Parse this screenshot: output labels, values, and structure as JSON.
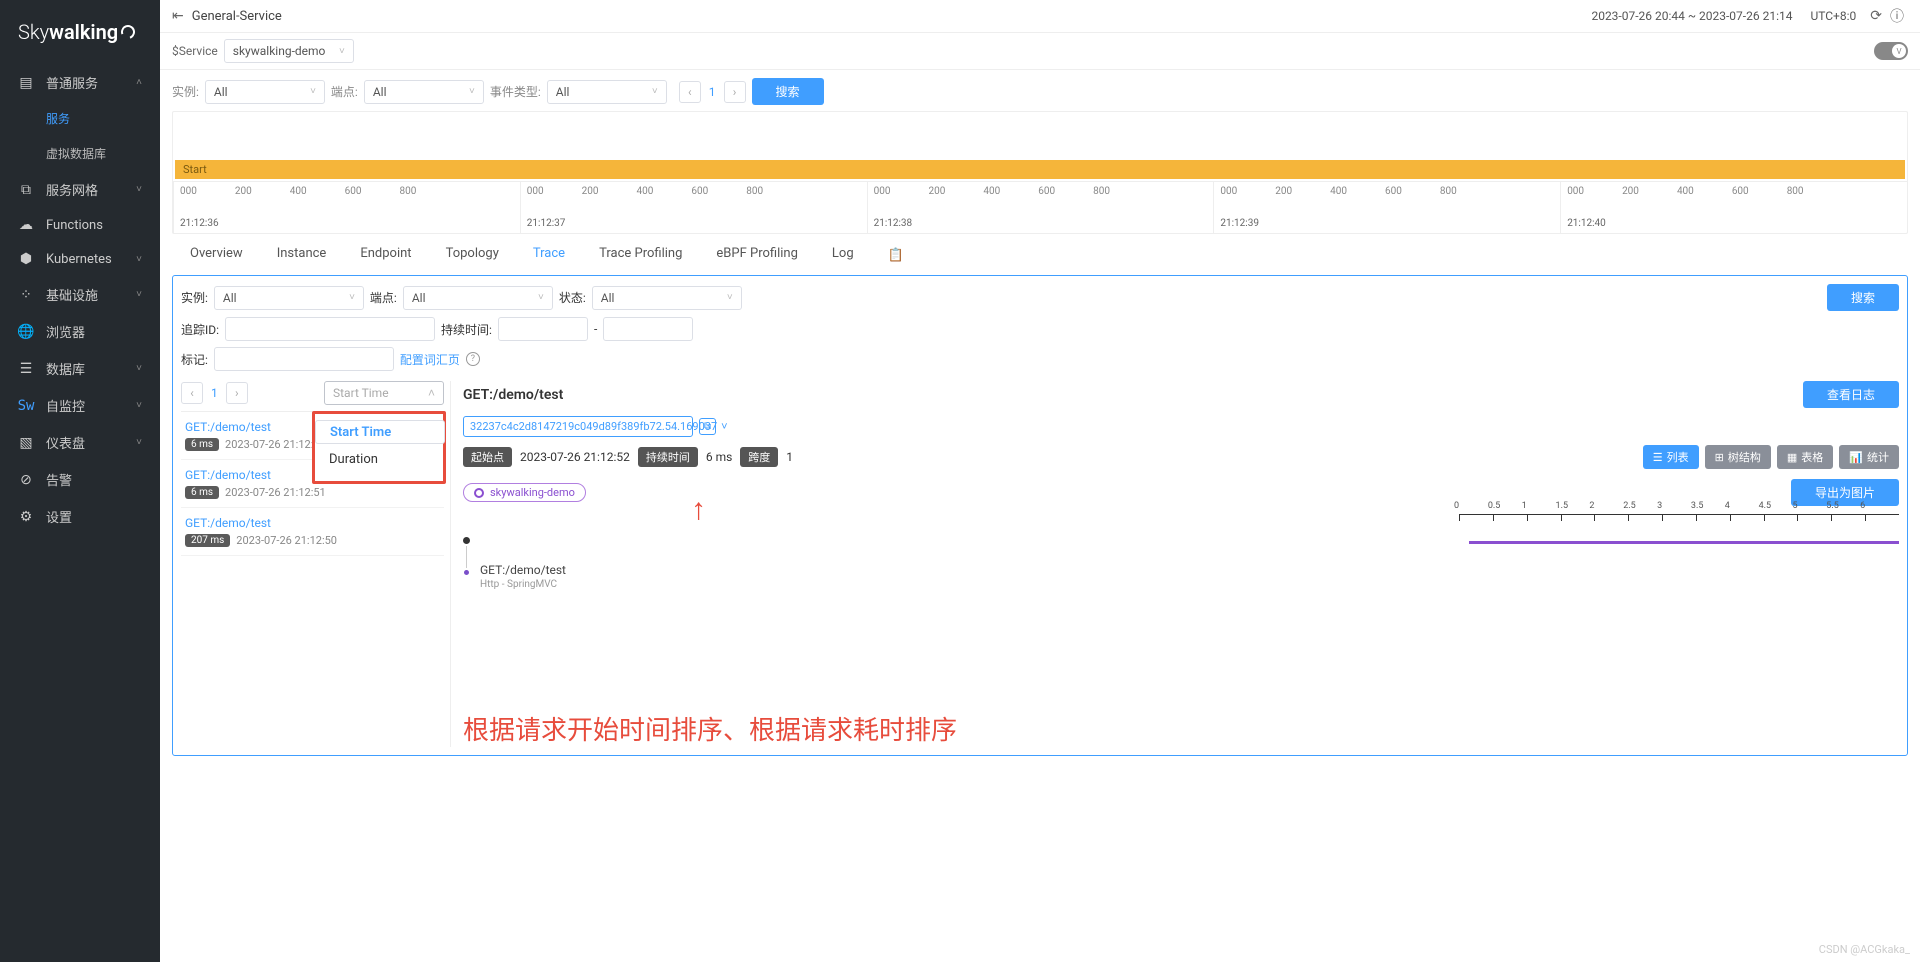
{
  "header": {
    "title": "General-Service",
    "time_range": "2023-07-26 20:44 ~ 2023-07-26 21:14",
    "timezone": "UTC+8:0"
  },
  "selector": {
    "service_label": "$Service",
    "service_value": "skywalking-demo"
  },
  "switch_label": "V",
  "sidebar": {
    "logo_a": "Sky",
    "logo_b": "walking",
    "items": [
      {
        "icon": "layers",
        "label": "普通服务",
        "expandable": true,
        "children": [
          {
            "label": "服务",
            "active": true
          },
          {
            "label": "虚拟数据库",
            "active": false
          }
        ]
      },
      {
        "icon": "mesh",
        "label": "服务网格",
        "expandable": true
      },
      {
        "icon": "cloud",
        "label": "Functions",
        "expandable": false
      },
      {
        "icon": "hex",
        "label": "Kubernetes",
        "expandable": true
      },
      {
        "icon": "infra",
        "label": "基础设施",
        "expandable": true
      },
      {
        "icon": "globe",
        "label": "浏览器",
        "expandable": false
      },
      {
        "icon": "db",
        "label": "数据库",
        "expandable": true
      },
      {
        "icon": "sw",
        "label": "自监控",
        "expandable": true
      },
      {
        "icon": "dash",
        "label": "仪表盘",
        "expandable": true
      },
      {
        "icon": "alert",
        "label": "告警",
        "expandable": false
      },
      {
        "icon": "gear",
        "label": "设置",
        "expandable": false
      }
    ]
  },
  "top_filter": {
    "instance_label": "实例:",
    "instance_value": "All",
    "endpoint_label": "端点:",
    "endpoint_value": "All",
    "event_type_label": "事件类型:",
    "event_type_value": "All",
    "page": "1",
    "search_btn": "搜索"
  },
  "timeline": {
    "start_label": "Start",
    "minor_ticks": [
      "000",
      "200",
      "400",
      "600",
      "800"
    ],
    "times": [
      "21:12:36",
      "21:12:37",
      "21:12:38",
      "21:12:39",
      "21:12:40"
    ]
  },
  "tabs": [
    "Overview",
    "Instance",
    "Endpoint",
    "Topology",
    "Trace",
    "Trace Profiling",
    "eBPF Profiling",
    "Log"
  ],
  "active_tab": "Trace",
  "trace_filter": {
    "instance_label": "实例:",
    "instance_value": "All",
    "endpoint_label": "端点:",
    "endpoint_value": "All",
    "status_label": "状态:",
    "status_value": "All",
    "traceid_label": "追踪ID:",
    "duration_label": "持续时间:",
    "dash": "-",
    "tag_label": "标记:",
    "lex_link": "配置词汇页",
    "search_btn": "搜索"
  },
  "sort": {
    "placeholder": "Start Time",
    "page": "1",
    "options": [
      {
        "label": "Start Time",
        "selected": true
      },
      {
        "label": "Duration",
        "selected": false
      }
    ]
  },
  "traces": [
    {
      "name": "GET:/demo/test",
      "ms": "6 ms",
      "time": "2023-07-26 21:12:52"
    },
    {
      "name": "GET:/demo/test",
      "ms": "6 ms",
      "time": "2023-07-26 21:12:51"
    },
    {
      "name": "GET:/demo/test",
      "ms": "207 ms",
      "time": "2023-07-26 21:12:50"
    }
  ],
  "detail": {
    "title": "GET:/demo/test",
    "view_log_btn": "查看日志",
    "trace_id": "32237c4c2d8147219c049d89f389fb72.54.169037",
    "start_label": "起始点",
    "start_value": "2023-07-26 21:12:52",
    "duration_label": "持续时间",
    "duration_value": "6 ms",
    "spans_label": "跨度",
    "spans_value": "1",
    "views": {
      "list": "列表",
      "tree": "树结构",
      "table": "表格",
      "stats": "统计"
    },
    "service_chip": "skywalking-demo",
    "export_btn": "导出为图片",
    "ruler_ticks": [
      "0",
      "0.5",
      "1",
      "1.5",
      "2",
      "2.5",
      "3",
      "3.5",
      "4",
      "4.5",
      "5",
      "5.5",
      "6"
    ],
    "span_name": "GET:/demo/test",
    "span_sub": "Http - SpringMVC"
  },
  "annotation_text": "根据请求开始时间排序、根据请求耗时排序",
  "watermark": "CSDN @ACGkaka_"
}
